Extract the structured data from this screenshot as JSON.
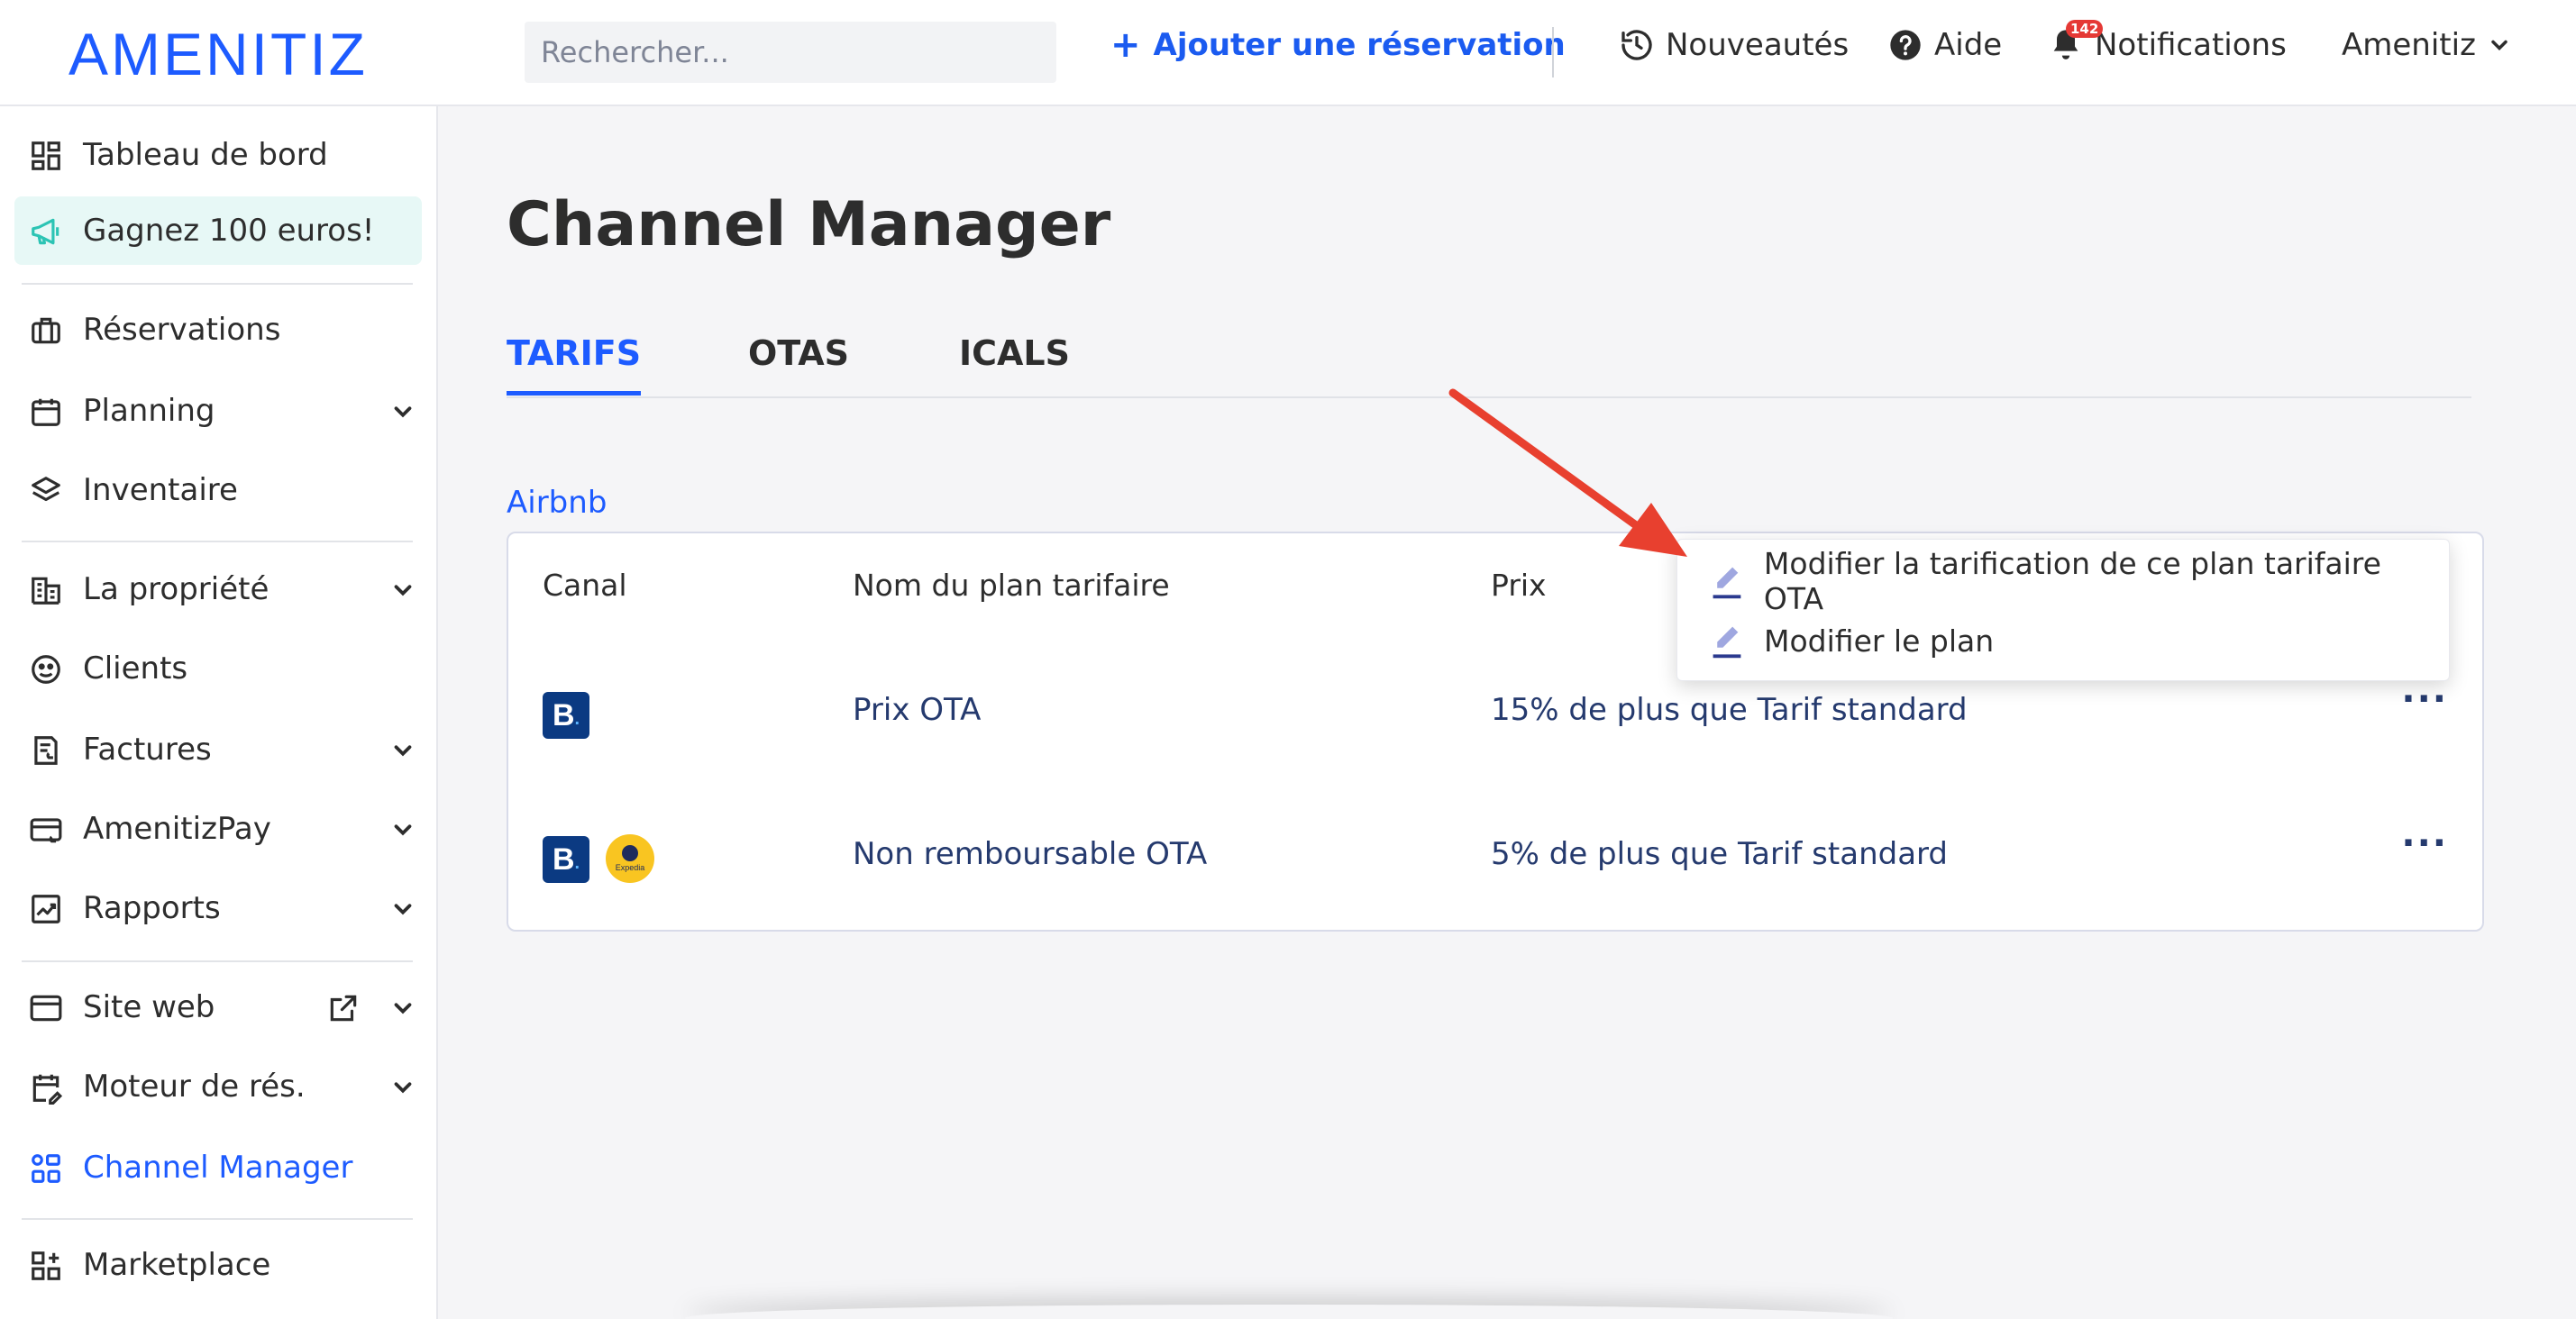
{
  "header": {
    "logo": "AMENITIZ",
    "search_placeholder": "Rechercher...",
    "add_reservation": "Ajouter une réservation",
    "news": "Nouveautés",
    "help": "Aide",
    "notifications": "Notifications",
    "notifications_count": "142",
    "account": "Amenitiz"
  },
  "sidebar": {
    "items": [
      {
        "label": "Tableau de bord",
        "icon": "dashboard-icon"
      },
      {
        "label": "Gagnez 100 euros!",
        "icon": "megaphone-icon"
      },
      {
        "label": "Réservations",
        "icon": "briefcase-icon"
      },
      {
        "label": "Planning",
        "icon": "calendar-icon"
      },
      {
        "label": "Inventaire",
        "icon": "layers-icon"
      },
      {
        "label": "La propriété",
        "icon": "building-icon"
      },
      {
        "label": "Clients",
        "icon": "face-icon"
      },
      {
        "label": "Factures",
        "icon": "invoice-icon"
      },
      {
        "label": "AmenitizPay",
        "icon": "card-icon"
      },
      {
        "label": "Rapports",
        "icon": "chart-icon"
      },
      {
        "label": "Site web",
        "icon": "browser-icon"
      },
      {
        "label": "Moteur de rés.",
        "icon": "calendar-edit-icon"
      },
      {
        "label": "Channel Manager",
        "icon": "channel-icon"
      },
      {
        "label": "Marketplace",
        "icon": "marketplace-icon"
      }
    ]
  },
  "main": {
    "title": "Channel Manager",
    "tabs": [
      {
        "label": "TARIFS",
        "active": true
      },
      {
        "label": "OTAS",
        "active": false
      },
      {
        "label": "ICALS",
        "active": false
      }
    ],
    "section": "Airbnb",
    "table": {
      "headers": [
        "Canal",
        "Nom du plan tarifaire",
        "Prix"
      ],
      "rows": [
        {
          "channels": [
            "booking"
          ],
          "name": "Prix OTA",
          "price": "15% de plus que Tarif standard"
        },
        {
          "channels": [
            "booking",
            "expedia"
          ],
          "name": "Non remboursable OTA",
          "price": "5% de plus que Tarif standard"
        }
      ]
    },
    "channel_logos": {
      "booking": "B",
      "booking_dot": ".",
      "expedia": "Expedia"
    },
    "more_label": "···",
    "menu": [
      {
        "label": "Modifier la tarification de ce plan tarifaire OTA",
        "icon": "pencil-icon"
      },
      {
        "label": "Modifier le plan",
        "icon": "pencil-icon"
      }
    ]
  },
  "colors": {
    "accent": "#1d5bff",
    "promo_bg": "#e7f8f6",
    "arrow": "#e8402f",
    "badge": "#e53935"
  }
}
